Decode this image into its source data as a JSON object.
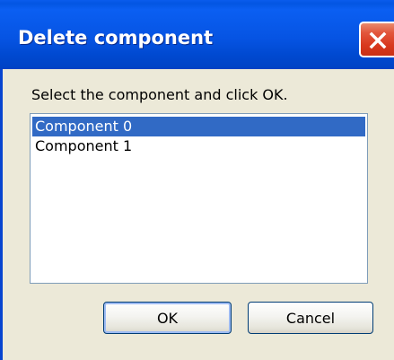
{
  "dialog": {
    "title": "Delete component",
    "prompt": "Select the component and click OK.",
    "close_icon": "close-icon"
  },
  "list": {
    "items": [
      {
        "label": "Component 0",
        "selected": true
      },
      {
        "label": "Component 1",
        "selected": false
      }
    ]
  },
  "buttons": {
    "ok_label": "OK",
    "cancel_label": "Cancel"
  },
  "colors": {
    "titlebar": "#0654e3",
    "close_button": "#d8371d",
    "selection": "#316ac5",
    "dialog_background": "#ece9d8"
  }
}
